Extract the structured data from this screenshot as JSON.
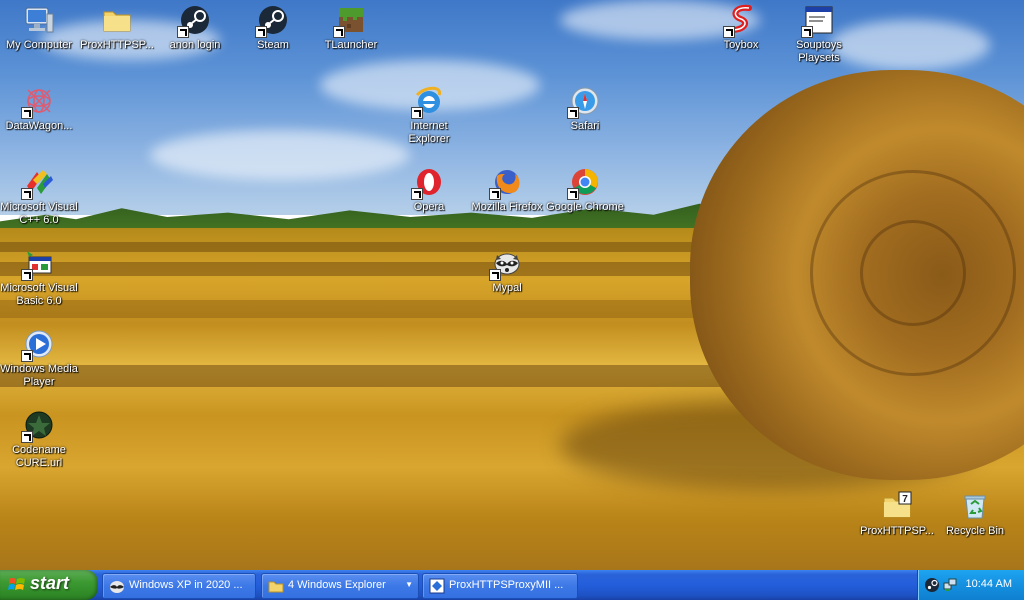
{
  "desktop_icons": [
    {
      "id": "my-computer",
      "label": "My Computer",
      "icon": "computer-icon"
    },
    {
      "id": "proxhttps-folder",
      "label": "ProxHTTPSP...",
      "icon": "folder-icon"
    },
    {
      "id": "anon-login",
      "label": "anon login",
      "icon": "steam-icon"
    },
    {
      "id": "steam",
      "label": "Steam",
      "icon": "steam-icon"
    },
    {
      "id": "tlauncher",
      "label": "TLauncher",
      "icon": "minecraft-grass-icon"
    },
    {
      "id": "toybox",
      "label": "Toybox",
      "icon": "toybox-s-icon"
    },
    {
      "id": "souptoys",
      "label": "Souptoys Playsets",
      "icon": "window-app-icon"
    },
    {
      "id": "datawagon",
      "label": "DataWagon...",
      "icon": "datawagon-icon"
    },
    {
      "id": "internet-explorer",
      "label": "Internet Explorer",
      "icon": "internet-explorer-icon"
    },
    {
      "id": "safari",
      "label": "Safari",
      "icon": "safari-icon"
    },
    {
      "id": "msvc",
      "label": "Microsoft Visual C++ 6.0",
      "icon": "visual-cpp-icon"
    },
    {
      "id": "opera",
      "label": "Opera",
      "icon": "opera-icon"
    },
    {
      "id": "firefox",
      "label": "Mozilla Firefox",
      "icon": "firefox-icon"
    },
    {
      "id": "chrome",
      "label": "Google Chrome",
      "icon": "chrome-icon"
    },
    {
      "id": "vb6",
      "label": "Microsoft Visual Basic 6.0",
      "icon": "visual-basic-icon"
    },
    {
      "id": "mypal",
      "label": "Mypal",
      "icon": "mypal-raccoon-icon"
    },
    {
      "id": "wmp",
      "label": "Windows Media Player",
      "icon": "media-player-icon"
    },
    {
      "id": "codename-cure",
      "label": "Codename CURE.url",
      "icon": "codename-cure-icon"
    },
    {
      "id": "proxhttps-zip",
      "label": "ProxHTTPSP...",
      "icon": "compressed-folder-icon"
    },
    {
      "id": "recycle-bin",
      "label": "Recycle Bin",
      "icon": "recycle-bin-icon"
    }
  ],
  "taskbar": {
    "start_label": "start",
    "tasks": [
      {
        "label": "Windows XP in 2020 ...",
        "icon": "raccoon-browser-icon"
      },
      {
        "label": "4 Windows Explorer",
        "icon": "folder-icon",
        "has_dropdown": true
      },
      {
        "label": "ProxHTTPSProxyMII ...",
        "icon": "proxy-app-icon"
      }
    ],
    "tray_icons": [
      "steam-tray-icon",
      "network-tray-icon"
    ],
    "clock": "10:44 AM"
  },
  "colors": {
    "taskbar_blue": "#245edb",
    "start_green": "#3d9a32",
    "tray_blue": "#1590e0"
  }
}
